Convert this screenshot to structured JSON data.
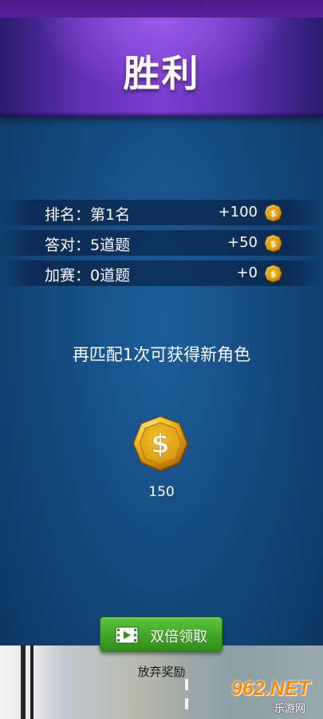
{
  "header": {
    "title": "胜利"
  },
  "rewards": [
    {
      "label": "排名：第1名",
      "value": "+100",
      "icon": "coin-icon"
    },
    {
      "label": "答对：5道题",
      "value": "+50",
      "icon": "coin-icon"
    },
    {
      "label": "加赛：0道题",
      "value": "+0",
      "icon": "coin-icon"
    }
  ],
  "message": "再匹配1次可获得新角色",
  "coin_total": {
    "amount": "150",
    "icon": "dollar-coin-icon"
  },
  "buttons": {
    "double_reward": "双倍领取",
    "double_reward_icon": "video-icon",
    "abandon": "放弃奖励"
  },
  "watermark": {
    "brand": "962.NET",
    "sub": "乐游网"
  },
  "colors": {
    "title_bar": "#6a34c0",
    "background": "#154d82",
    "button_green": "#3fa528",
    "coin_gold": "#f2b51c"
  }
}
